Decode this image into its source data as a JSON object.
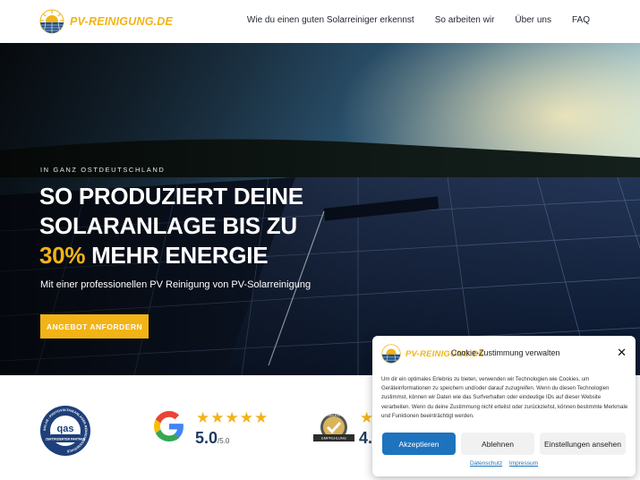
{
  "brand": {
    "name": "PV-REINIGUNG.DE",
    "accent_color": "#f2b316",
    "logo_icon": "sun-panel-logo-icon"
  },
  "nav": {
    "items": [
      {
        "label": "Wie du einen guten Solarreiniger erkennst"
      },
      {
        "label": "So arbeiten wir"
      },
      {
        "label": "Über uns"
      },
      {
        "label": "FAQ"
      }
    ]
  },
  "hero": {
    "eyebrow": "IN GANZ OSTDEUTSCHLAND",
    "headline_line1": "SO PRODUZIERT DEINE",
    "headline_line2": "SOLARANLAGE BIS ZU",
    "headline_accent": "30%",
    "headline_rest": " MEHR ENERGIE",
    "subline": "Mit einer professionellen PV Reinigung von PV-Solarreinigung",
    "cta_label": "ANGEBOT ANFORDERN"
  },
  "badges": {
    "qas_label": "qas",
    "qas_ring_text": "SOLAR - PHOTOVOLTAIKANLAGEN REINIGUNGSSERVICE",
    "qas_sub": "ZERTIFIZIERTER PARTNER",
    "google_stars": "★★★★★",
    "google_rating": "5.0",
    "google_scale": "/5.0",
    "expert_label": "PROVEN EXPERT",
    "expert_sub": "EMPFEHLUNG",
    "expert_stars": "★",
    "expert_rating": "4."
  },
  "cookie": {
    "title": "Cookie-Zustimmung verwalten",
    "logo_text": "PV-REINIGUNG.DE",
    "body": "Um dir ein optimales Erlebnis zu bieten, verwenden wir Technologien wie Cookies, um Geräteinformationen zu speichern und/oder darauf zuzugreifen. Wenn du diesen Technologien zustimmst, können wir Daten wie das Surfverhalten oder eindeutige IDs auf dieser Website verarbeiten. Wenn du deine Zustimmung nicht erteilst oder zurückziehst, können bestimmte Merkmale und Funktionen beeinträchtigt werden.",
    "accept_label": "Akzeptieren",
    "deny_label": "Ablehnen",
    "settings_label": "Einstellungen ansehen",
    "link_privacy": "Datenschutz",
    "link_imprint": "Impressum",
    "close_symbol": "✕",
    "primary_color": "#1e73be"
  }
}
